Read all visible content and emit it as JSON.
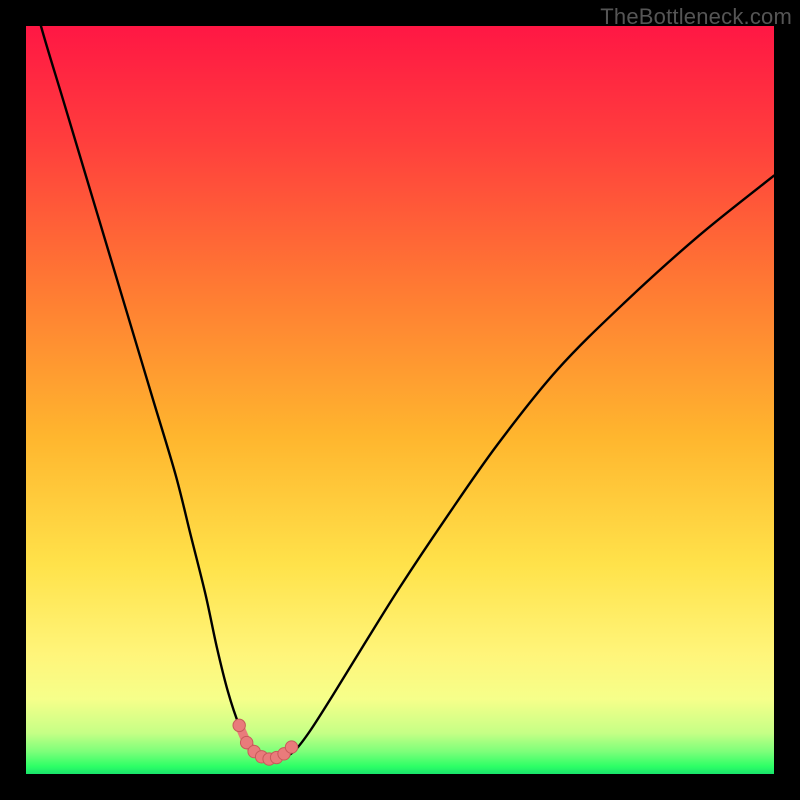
{
  "watermark": "TheBottleneck.com",
  "colors": {
    "frame": "#000000",
    "curve": "#000000",
    "markers_fill": "#e97b7b",
    "markers_stroke": "#c85a5a",
    "green_band": "#19e36b"
  },
  "chart_data": {
    "type": "line",
    "title": "",
    "xlabel": "",
    "ylabel": "",
    "xlim": [
      0,
      100
    ],
    "ylim": [
      0,
      100
    ],
    "gradient_stops": [
      {
        "offset": 0.0,
        "color": "#ff1744"
      },
      {
        "offset": 0.15,
        "color": "#ff3d3d"
      },
      {
        "offset": 0.35,
        "color": "#ff7a33"
      },
      {
        "offset": 0.55,
        "color": "#ffb62e"
      },
      {
        "offset": 0.72,
        "color": "#ffe24a"
      },
      {
        "offset": 0.84,
        "color": "#fff57a"
      },
      {
        "offset": 0.9,
        "color": "#f6ff8a"
      },
      {
        "offset": 0.945,
        "color": "#c6ff86"
      },
      {
        "offset": 0.97,
        "color": "#7dff7a"
      },
      {
        "offset": 0.99,
        "color": "#2dff66"
      },
      {
        "offset": 1.0,
        "color": "#19e36b"
      }
    ],
    "series": [
      {
        "name": "bottleneck-curve",
        "x": [
          0,
          2,
          5,
          8,
          11,
          14,
          17,
          20,
          22,
          24,
          25.5,
          27,
          28.5,
          30,
          31.5,
          33,
          34.5,
          36,
          38,
          41,
          45,
          50,
          56,
          63,
          71,
          80,
          90,
          100
        ],
        "y": [
          108,
          100,
          90,
          80,
          70,
          60,
          50,
          40,
          32,
          24,
          17,
          11,
          6.5,
          3.5,
          2.2,
          2.0,
          2.2,
          3.2,
          5.8,
          10.5,
          17,
          25,
          34,
          44,
          54,
          63,
          72,
          80
        ]
      }
    ],
    "markers": {
      "name": "highlight-range",
      "x": [
        28.5,
        29.5,
        30.5,
        31.5,
        32.5,
        33.5,
        34.5,
        35.5
      ],
      "y": [
        6.5,
        4.2,
        3.0,
        2.3,
        2.0,
        2.2,
        2.7,
        3.6
      ]
    }
  }
}
